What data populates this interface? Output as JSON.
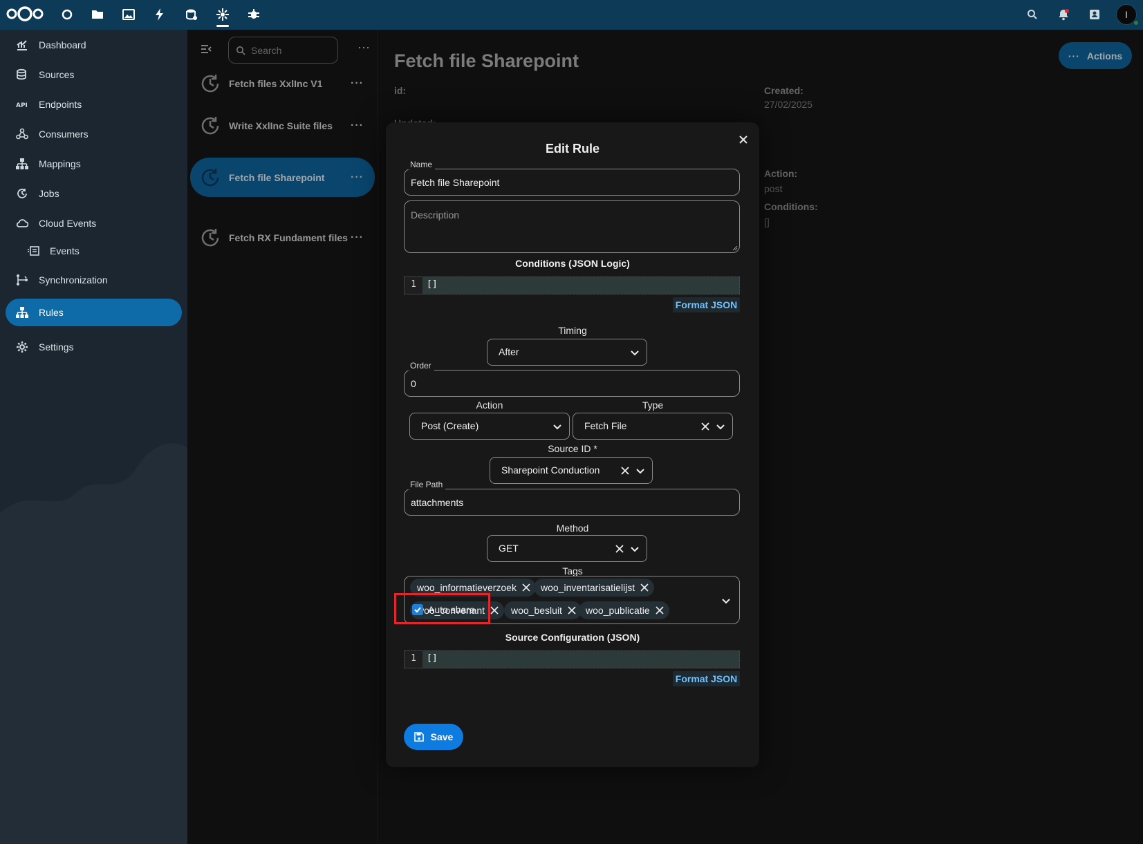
{
  "topbar": {
    "apps": [
      "dashboard-icon",
      "circle-icon",
      "files-icon",
      "photos-icon",
      "activity-icon",
      "database-icon",
      "openconnector-icon",
      "bug-icon"
    ],
    "right_icons": [
      "search-icon",
      "notifications-icon",
      "contacts-icon"
    ],
    "avatar_initial": "I"
  },
  "nav": {
    "items": [
      {
        "label": "Dashboard",
        "icon": "chart-icon"
      },
      {
        "label": "Sources",
        "icon": "database-icon"
      },
      {
        "label": "Endpoints",
        "icon": "api-icon"
      },
      {
        "label": "Consumers",
        "icon": "consumers-icon"
      },
      {
        "label": "Mappings",
        "icon": "sitemap-icon"
      },
      {
        "label": "Jobs",
        "icon": "clock-icon"
      },
      {
        "label": "Cloud Events",
        "icon": "cloud-icon"
      },
      {
        "label": "Events",
        "icon": "events-icon"
      },
      {
        "label": "Synchronization",
        "icon": "sync-icon"
      },
      {
        "label": "Rules",
        "icon": "rules-icon"
      },
      {
        "label": "Settings",
        "icon": "gear-icon"
      }
    ],
    "active": "Rules"
  },
  "list": {
    "search_placeholder": "Search",
    "items": [
      {
        "label": "Fetch files XxlInc V1"
      },
      {
        "label": "Write XxlInc Suite files"
      },
      {
        "label": "Fetch file Sharepoint"
      },
      {
        "label": "Fetch RX Fundament files"
      }
    ],
    "active": "Fetch file Sharepoint"
  },
  "detail": {
    "title": "Fetch file Sharepoint",
    "actions_label": "Actions",
    "id_label": "id:",
    "updated_label": "Updated:",
    "created_label": "Created:",
    "created_value": "27/02/2025",
    "action_label": "Action:",
    "action_value": "post",
    "conditions_label": "Conditions:",
    "conditions_value": "[]"
  },
  "modal": {
    "title": "Edit Rule",
    "name_label": "Name",
    "name_value": "Fetch file Sharepoint",
    "description_placeholder": "Description",
    "conditions_title": "Conditions (JSON Logic)",
    "conditions_line": "1",
    "conditions_code": "[]",
    "format_json": "Format JSON",
    "timing_label": "Timing",
    "timing_value": "After",
    "order_label": "Order",
    "order_value": "0",
    "action_label": "Action",
    "action_value": "Post (Create)",
    "type_label": "Type",
    "type_value": "Fetch File",
    "source_label": "Source ID *",
    "source_value": "Sharepoint Conduction",
    "filepath_label": "File Path",
    "filepath_value": "attachments",
    "method_label": "Method",
    "method_value": "GET",
    "tags_label": "Tags",
    "tags": [
      "woo_informatieverzoek",
      "woo_inventarisatielijst",
      "woo_convenant",
      "woo_besluit",
      "woo_publicatie"
    ],
    "autoshare_label": "Auto share",
    "autoshare_checked": true,
    "source_config_title": "Source Configuration (JSON)",
    "source_config_line": "1",
    "source_config_code": "[]",
    "save_label": "Save"
  },
  "colors": {
    "topbar": "#0c3a57",
    "accent": "#0e6ba8",
    "highlight": "#e4262b"
  }
}
